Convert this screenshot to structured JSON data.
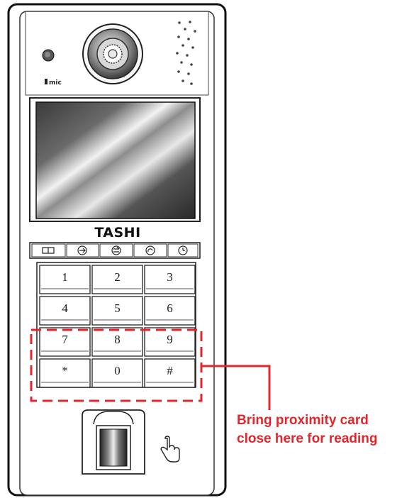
{
  "device": {
    "brand": "TASHI",
    "mic_label": "mic",
    "function_icons": [
      "book-icon",
      "call-in-icon",
      "call-out-icon",
      "refresh-icon",
      "clock-icon"
    ],
    "keypad": [
      [
        "1",
        "2",
        "3"
      ],
      [
        "4",
        "5",
        "6"
      ],
      [
        "7",
        "8",
        "9"
      ],
      [
        "*",
        "0",
        "#"
      ]
    ]
  },
  "annotation": {
    "line1": "Bring proximity card",
    "line2": "close here for reading",
    "color": "#e3262c"
  }
}
